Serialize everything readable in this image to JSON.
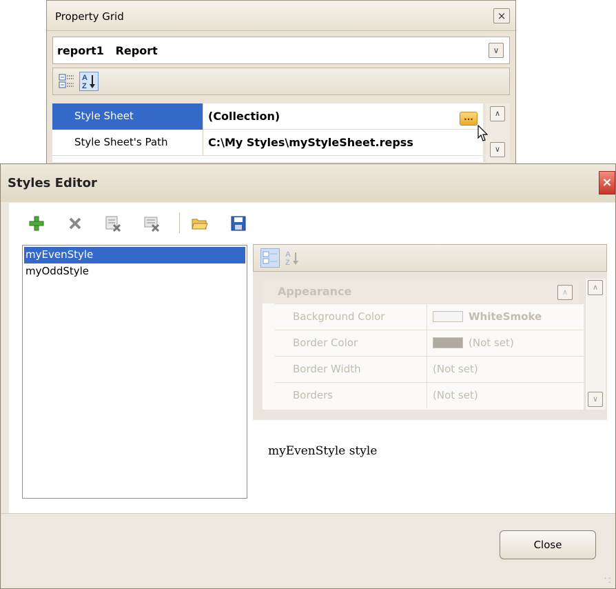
{
  "property_grid": {
    "title": "Property Grid",
    "close": "×",
    "object_selector": "report1   Report",
    "toolbar_icons": [
      "categorized-icon",
      "alphabetical-sort-icon"
    ],
    "rows": [
      {
        "name": "Style Sheet",
        "value": "(Collection)",
        "selected": true
      },
      {
        "name": "Style Sheet's Path",
        "value": "C:\\My Styles\\myStyleSheet.repss"
      }
    ],
    "ellipsis": "..."
  },
  "styles_editor": {
    "title": "Styles Editor",
    "close_glyph": "×",
    "toolbar_icons": [
      "add-icon",
      "delete-icon",
      "remove-unused-icon",
      "purge-icon",
      "open-folder-icon",
      "save-icon"
    ],
    "styles": [
      "myEvenStyle",
      "myOddStyle"
    ],
    "selected_style": "myEvenStyle",
    "inner_grid": {
      "category": "Appearance",
      "rows": [
        {
          "name": "Background Color",
          "value": "WhiteSmoke",
          "swatch": "#f5f5f5"
        },
        {
          "name": "Border Color",
          "value": "(Not set)",
          "swatch": "#b0aba1"
        },
        {
          "name": "Border Width",
          "value": "(Not set)"
        },
        {
          "name": "Borders",
          "value": "(Not set)"
        }
      ]
    },
    "description": "myEvenStyle style",
    "close_button": "Close"
  },
  "colors": {
    "selection": "#3469c7",
    "accent": "#f0a92a",
    "close_red": "#c8362a"
  }
}
